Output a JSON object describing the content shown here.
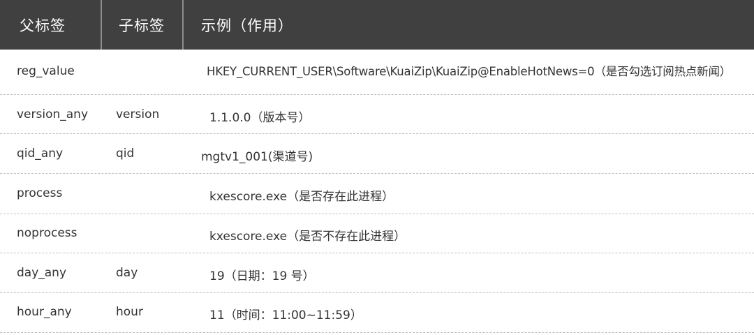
{
  "header": {
    "col_parent": "父标签",
    "col_child": "子标签",
    "col_example": "示例（作用）"
  },
  "rows": [
    {
      "parent": "reg_value",
      "child": "",
      "example": "HKEY_CURRENT_USER\\Software\\KuaiZip\\KuaiZip@EnableHotNews=0（是否勾选订阅热点新闻）"
    },
    {
      "parent": "version_any",
      "child": "version",
      "example": "1.1.0.0（版本号）"
    },
    {
      "parent": "qid_any",
      "child": "qid",
      "example": "mgtv1_001(渠道号)"
    },
    {
      "parent": "process",
      "child": "",
      "example": "kxescore.exe（是否存在此进程）"
    },
    {
      "parent": "noprocess",
      "child": "",
      "example": "kxescore.exe（是否不存在此进程）"
    },
    {
      "parent": "day_any",
      "child": "day",
      "example": "19（日期：19 号）"
    },
    {
      "parent": "hour_any",
      "child": "hour",
      "example": "11（时间：11:00~11:59）"
    }
  ]
}
